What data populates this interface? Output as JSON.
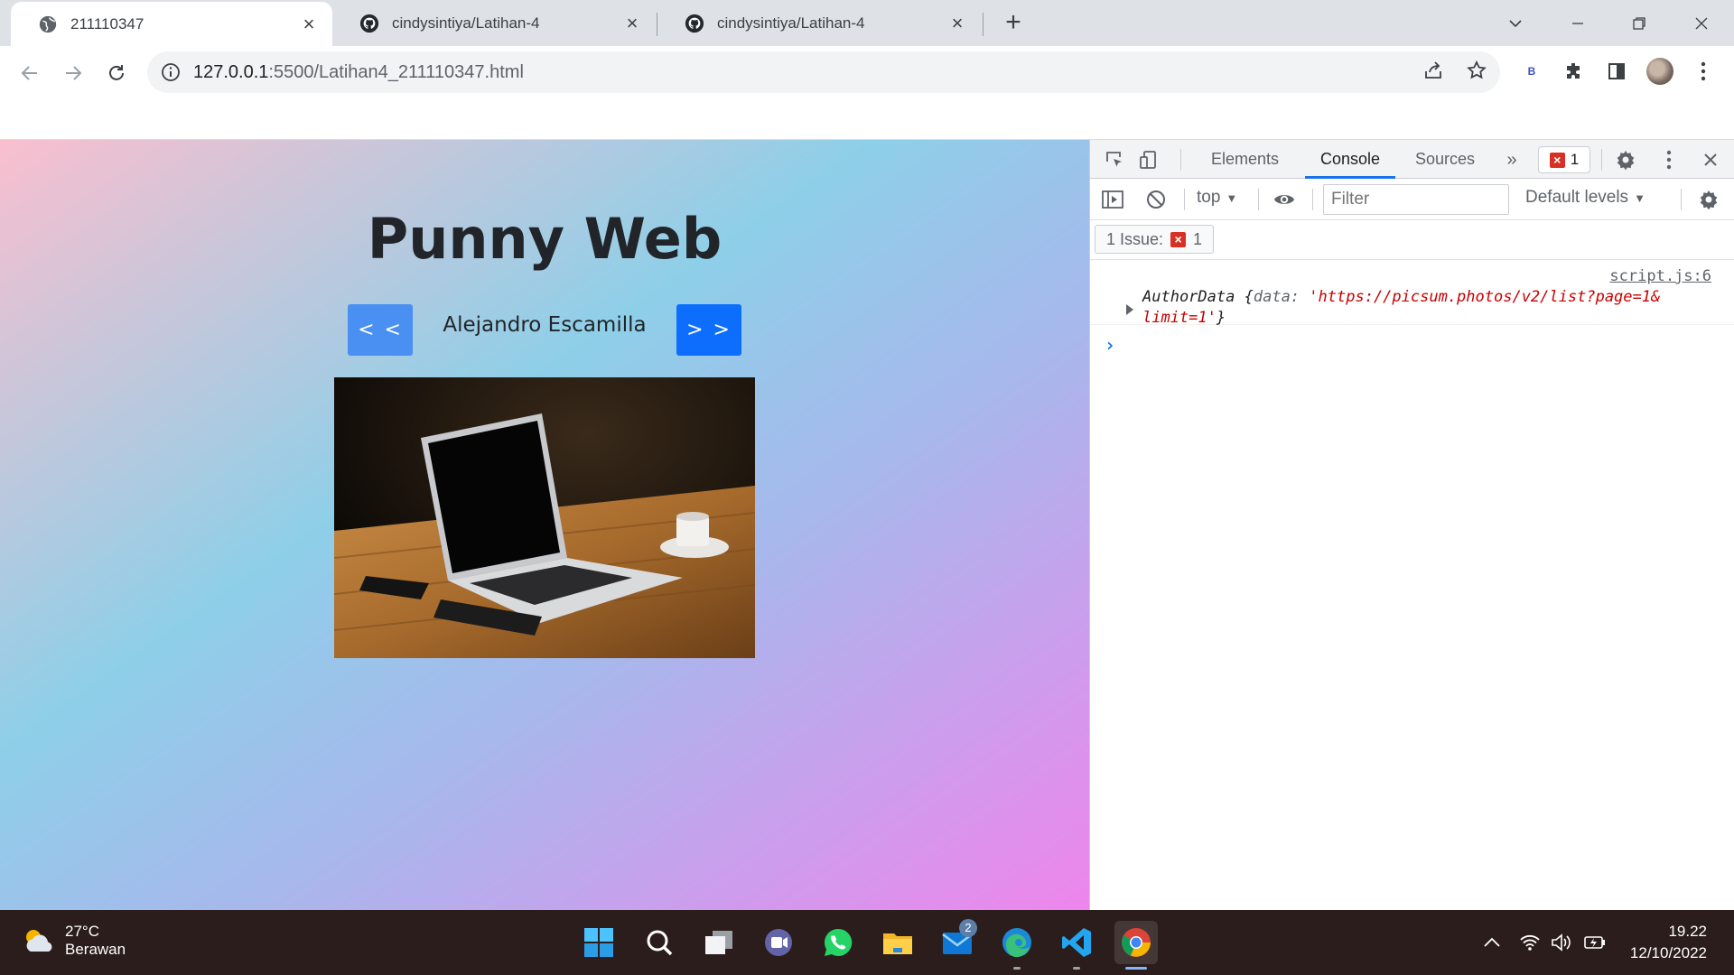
{
  "browser": {
    "tabs": [
      {
        "title": "211110347",
        "active": true,
        "icon": "globe-icon"
      },
      {
        "title": "cindysintiya/Latihan-4",
        "active": false,
        "icon": "github-icon"
      },
      {
        "title": "cindysintiya/Latihan-4",
        "active": false,
        "icon": "github-icon"
      }
    ],
    "address": {
      "host": "127.0.0.1",
      "rest": ":5500/Latihan4_211110347.html"
    },
    "extension_label": "B"
  },
  "page": {
    "title": "Punny Web",
    "prev_label": "< <",
    "next_label": "> >",
    "author": "Alejandro Escamilla"
  },
  "devtools": {
    "tabs": [
      "Elements",
      "Console",
      "Sources"
    ],
    "active_tab": "Console",
    "error_count": "1",
    "context": "top",
    "filter_placeholder": "Filter",
    "levels": "Default levels",
    "issues_label": "1 Issue:",
    "issues_count": "1",
    "log": {
      "source": "script.js:6",
      "class_name": "AuthorData",
      "open": "{",
      "key": "data:",
      "value_line1": "'https://picsum.photos/v2/list?page=1&",
      "value_line2": "limit=1'",
      "close": "}"
    },
    "prompt": "›"
  },
  "taskbar": {
    "weather_temp": "27°C",
    "weather_desc": "Berawan",
    "mail_badge": "2",
    "time": "19.22",
    "date": "12/10/2022"
  },
  "colors": {
    "accent": "#1a73e8",
    "prev_button": "#4a8ff2",
    "next_button": "#0d6efd",
    "error": "#d93025",
    "taskbar": "#2b1d1b"
  }
}
